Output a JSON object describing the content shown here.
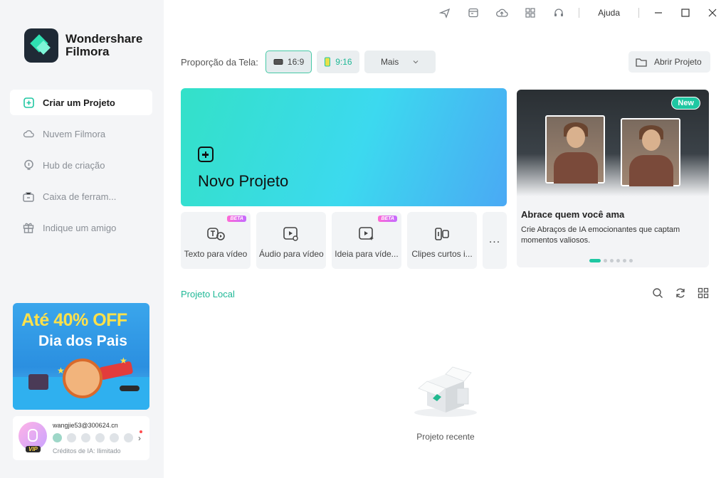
{
  "app": {
    "brand_line1": "Wondershare",
    "brand_line2": "Filmora"
  },
  "sidebar": {
    "items": [
      {
        "label": "Criar um Projeto",
        "icon": "plus-square-icon",
        "active": true
      },
      {
        "label": "Nuvem Filmora",
        "icon": "cloud-icon"
      },
      {
        "label": "Hub de criação",
        "icon": "bulb-icon"
      },
      {
        "label": "Caixa de ferram...",
        "icon": "toolbox-icon"
      },
      {
        "label": "Indique um amigo",
        "icon": "gift-icon"
      }
    ],
    "promo": {
      "line1": "Até 40% OFF",
      "line2": "Dia dos Pais"
    },
    "user": {
      "email": "wangjie53@300624.cn",
      "badge": "VIP",
      "credits": "Créditos de IA: Ilimitado"
    }
  },
  "titlebar": {
    "help": "Ajuda",
    "icons": [
      "send-icon",
      "calendar-icon",
      "cloud-upload-icon",
      "apps-grid-icon",
      "headset-icon"
    ]
  },
  "ratio": {
    "label": "Proporção da Tela:",
    "options": [
      {
        "label": "16:9",
        "selected": true
      },
      {
        "label": "9:16"
      }
    ],
    "more": "Mais"
  },
  "open_project": "Abrir Projeto",
  "hero": {
    "label": "Novo Projeto"
  },
  "tools": [
    {
      "label": "Texto para vídeo",
      "beta": "BETA",
      "icon": "text-to-video-icon"
    },
    {
      "label": "Áudio para vídeo",
      "icon": "audio-to-video-icon"
    },
    {
      "label": "Ideia para víde...",
      "beta": "BETA",
      "icon": "idea-to-video-icon"
    },
    {
      "label": "Clipes curtos i...",
      "icon": "short-clips-icon"
    },
    {
      "label": "...",
      "icon": "more-icon"
    }
  ],
  "feature": {
    "badge": "New",
    "title": "Abrace quem você ama",
    "description": "Crie Abraços de IA emocionantes que captam momentos valiosos.",
    "dots": 6,
    "active_dot": 0
  },
  "local": {
    "title": "Projeto Local",
    "empty_label": "Projeto recente"
  },
  "colors": {
    "accent": "#1fc7a2",
    "sidebar_bg": "#f4f5f7",
    "hero_start": "#33e1c8",
    "hero_end": "#4aa9f4"
  }
}
